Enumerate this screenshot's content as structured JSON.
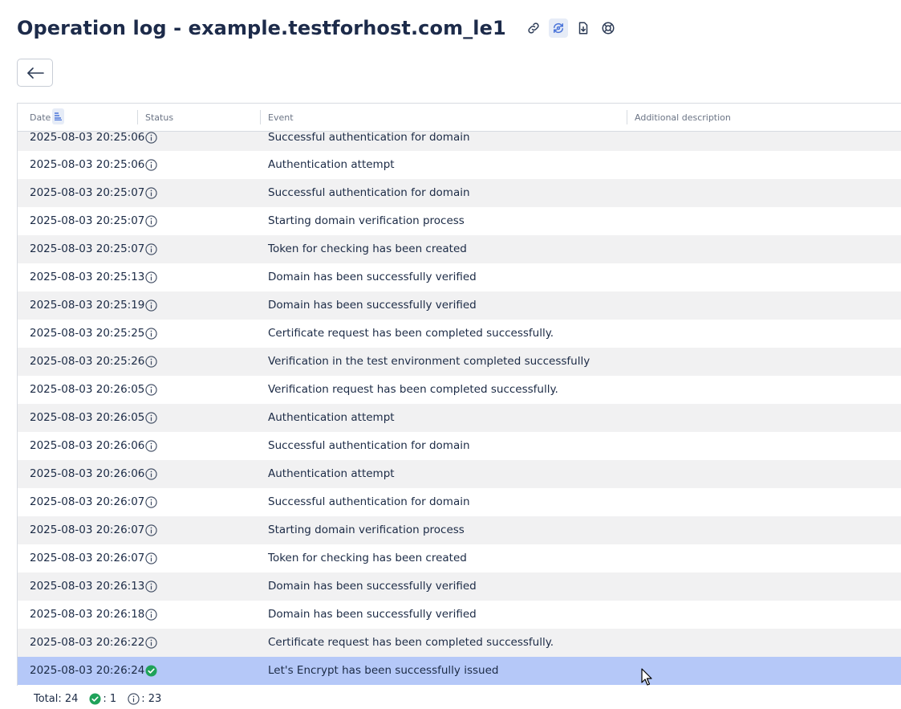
{
  "header": {
    "title": "Operation log - example.testforhost.com_le1",
    "icons": [
      "link-icon",
      "sync-icon",
      "download-icon",
      "help-icon"
    ]
  },
  "toolbar": {
    "back_icon": "arrow-left-icon"
  },
  "table": {
    "columns": [
      {
        "label": "Date"
      },
      {
        "label": "Status"
      },
      {
        "label": "Event"
      },
      {
        "label": "Additional description"
      }
    ],
    "rows": [
      {
        "date": "2025-08-03 20:25:06",
        "status": "info",
        "event": "Successful authentication for domain",
        "desc": ""
      },
      {
        "date": "2025-08-03 20:25:06",
        "status": "info",
        "event": "Authentication attempt",
        "desc": ""
      },
      {
        "date": "2025-08-03 20:25:07",
        "status": "info",
        "event": "Successful authentication for domain",
        "desc": ""
      },
      {
        "date": "2025-08-03 20:25:07",
        "status": "info",
        "event": "Starting domain verification process",
        "desc": ""
      },
      {
        "date": "2025-08-03 20:25:07",
        "status": "info",
        "event": "Token for checking has been created",
        "desc": ""
      },
      {
        "date": "2025-08-03 20:25:13",
        "status": "info",
        "event": "Domain has been successfully verified",
        "desc": ""
      },
      {
        "date": "2025-08-03 20:25:19",
        "status": "info",
        "event": "Domain has been successfully verified",
        "desc": ""
      },
      {
        "date": "2025-08-03 20:25:25",
        "status": "info",
        "event": "Certificate request has been completed successfully.",
        "desc": ""
      },
      {
        "date": "2025-08-03 20:25:26",
        "status": "info",
        "event": "Verification in the test environment completed successfully",
        "desc": ""
      },
      {
        "date": "2025-08-03 20:26:05",
        "status": "info",
        "event": "Verification request has been completed successfully.",
        "desc": ""
      },
      {
        "date": "2025-08-03 20:26:05",
        "status": "info",
        "event": "Authentication attempt",
        "desc": ""
      },
      {
        "date": "2025-08-03 20:26:06",
        "status": "info",
        "event": "Successful authentication for domain",
        "desc": ""
      },
      {
        "date": "2025-08-03 20:26:06",
        "status": "info",
        "event": "Authentication attempt",
        "desc": ""
      },
      {
        "date": "2025-08-03 20:26:07",
        "status": "info",
        "event": "Successful authentication for domain",
        "desc": ""
      },
      {
        "date": "2025-08-03 20:26:07",
        "status": "info",
        "event": "Starting domain verification process",
        "desc": ""
      },
      {
        "date": "2025-08-03 20:26:07",
        "status": "info",
        "event": "Token for checking has been created",
        "desc": ""
      },
      {
        "date": "2025-08-03 20:26:13",
        "status": "info",
        "event": "Domain has been successfully verified",
        "desc": ""
      },
      {
        "date": "2025-08-03 20:26:18",
        "status": "info",
        "event": "Domain has been successfully verified",
        "desc": ""
      },
      {
        "date": "2025-08-03 20:26:22",
        "status": "info",
        "event": "Certificate request has been completed successfully.",
        "desc": ""
      },
      {
        "date": "2025-08-03 20:26:24",
        "status": "success",
        "event": "Let's Encrypt has been successfully issued",
        "desc": "",
        "selected": true
      }
    ]
  },
  "footer": {
    "total_label": "Total: 24",
    "success_count": ": 1",
    "info_count": ": 23"
  },
  "colors": {
    "title": "#1d2b4a",
    "selected_row": "#b5c8f8",
    "striped_row": "#f1f1f2",
    "success": "#1fa25a",
    "accent": "#4a74d9"
  }
}
